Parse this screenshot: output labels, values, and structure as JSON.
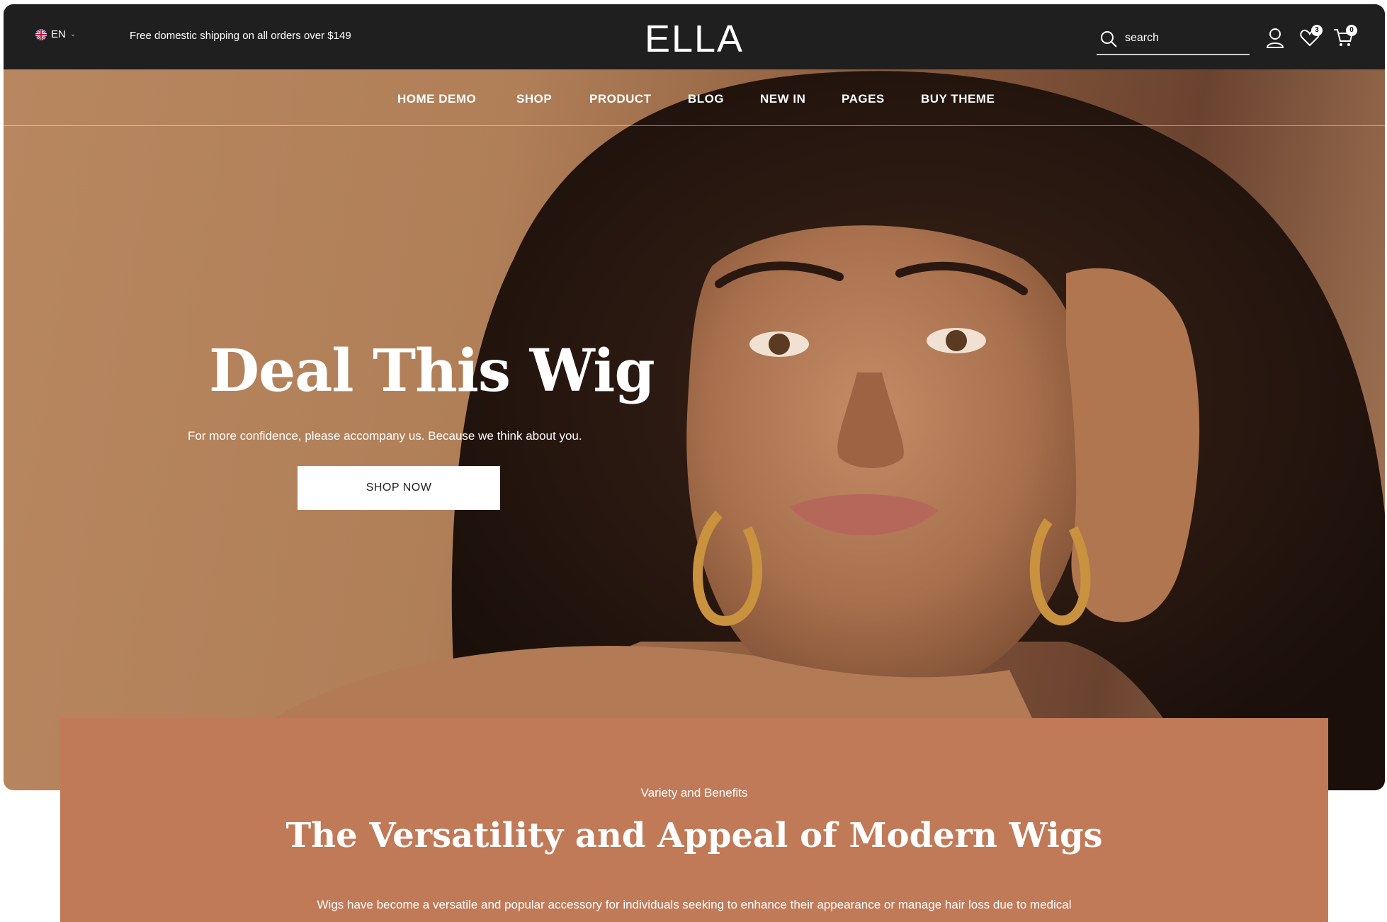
{
  "header": {
    "language": "EN",
    "promo_text": "Free domestic shipping on all orders over $149",
    "logo": "ELLA",
    "search": {
      "placeholder": "search"
    },
    "wishlist_count": "3",
    "cart_count": "0"
  },
  "nav": {
    "items": [
      {
        "label": "HOME DEMO"
      },
      {
        "label": "SHOP"
      },
      {
        "label": "PRODUCT"
      },
      {
        "label": "BLOG"
      },
      {
        "label": "NEW IN"
      },
      {
        "label": "PAGES"
      },
      {
        "label": "BUY THEME"
      }
    ]
  },
  "hero": {
    "title": "Deal This Wig",
    "subtitle": "For more confidence, please accompany us. Because we think about you.",
    "button": "SHOP NOW"
  },
  "benefits": {
    "kicker": "Variety and Benefits",
    "title": "The Versatility and Appeal of Modern Wigs",
    "body": "Wigs have become a versatile and popular accessory for individuals seeking to enhance their appearance or manage hair loss due to medical"
  },
  "colors": {
    "topbar": "#1f1f1f",
    "hero_background": "#b38560",
    "benefits_background": "#c07a58",
    "button_background": "#ffffff"
  },
  "icons": [
    "uk-flag-icon",
    "chevron-down-icon",
    "search-icon",
    "user-icon",
    "heart-icon",
    "cart-icon"
  ]
}
